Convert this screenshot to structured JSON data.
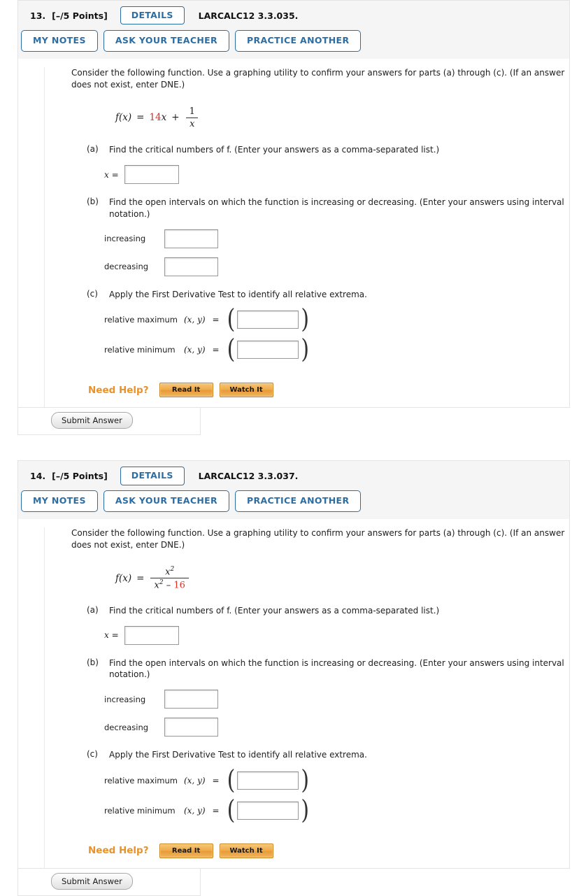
{
  "questions": [
    {
      "number": "13.",
      "points": "[–/5 Points]",
      "details_label": "DETAILS",
      "code": "LARCALC12 3.3.035.",
      "buttons": [
        "MY NOTES",
        "ASK YOUR TEACHER",
        "PRACTICE ANOTHER"
      ],
      "prompt": "Consider the following function. Use a graphing utility to confirm your answers for parts (a) through (c). (If an answer does not exist, enter DNE.)",
      "formula": {
        "lhs": "f(x)",
        "equals": "=",
        "coefficient": "14",
        "variable": "x",
        "plus": "+",
        "frac_num": "1",
        "frac_den": "x"
      },
      "parts": [
        {
          "label": "(a)",
          "text": "Find the critical numbers of f. (Enter your answers as a comma-separated list.)",
          "answers": [
            {
              "label": "x =",
              "type": "single"
            }
          ]
        },
        {
          "label": "(b)",
          "text": "Find the open intervals on which the function is increasing or decreasing. (Enter your answers using interval notation.)",
          "answers": [
            {
              "label": "increasing",
              "type": "single"
            },
            {
              "label": "decreasing",
              "type": "single"
            }
          ]
        },
        {
          "label": "(c)",
          "text": "Apply the First Derivative Test to identify all relative extrema.",
          "answers": [
            {
              "label": "relative maximum",
              "type": "pair",
              "coords": "(x, y)",
              "equals": "="
            },
            {
              "label": "relative minimum",
              "type": "pair",
              "coords": "(x, y)",
              "equals": "="
            }
          ]
        }
      ],
      "need_help_label": "Need Help?",
      "help_buttons": [
        "Read It",
        "Watch It"
      ],
      "submit_label": "Submit Answer"
    },
    {
      "number": "14.",
      "points": "[–/5 Points]",
      "details_label": "DETAILS",
      "code": "LARCALC12 3.3.037.",
      "buttons": [
        "MY NOTES",
        "ASK YOUR TEACHER",
        "PRACTICE ANOTHER"
      ],
      "prompt": "Consider the following function. Use a graphing utility to confirm your answers for parts (a) through (c). (If an answer does not exist, enter DNE.)",
      "formula": {
        "lhs": "f(x)",
        "equals": "=",
        "frac_num_base": "x",
        "frac_num_exp": "2",
        "frac_den_base": "x",
        "frac_den_exp": "2",
        "frac_den_minus": "–",
        "frac_den_const": "16"
      },
      "parts": [
        {
          "label": "(a)",
          "text": "Find the critical numbers of f. (Enter your answers as a comma-separated list.)",
          "answers": [
            {
              "label": "x =",
              "type": "single"
            }
          ]
        },
        {
          "label": "(b)",
          "text": "Find the open intervals on which the function is increasing or decreasing. (Enter your answers using interval notation.)",
          "answers": [
            {
              "label": "increasing",
              "type": "single"
            },
            {
              "label": "decreasing",
              "type": "single"
            }
          ]
        },
        {
          "label": "(c)",
          "text": "Apply the First Derivative Test to identify all relative extrema.",
          "answers": [
            {
              "label": "relative maximum",
              "type": "pair",
              "coords": "(x, y)",
              "equals": "="
            },
            {
              "label": "relative minimum",
              "type": "pair",
              "coords": "(x, y)",
              "equals": "="
            }
          ]
        }
      ],
      "need_help_label": "Need Help?",
      "help_buttons": [
        "Read It",
        "Watch It"
      ],
      "submit_label": "Submit Answer"
    }
  ],
  "colors": {
    "accent_blue": "#2c6ea4",
    "help_orange": "#e8922a",
    "formula_red": "#d93025",
    "panel_gray": "#f5f5f5"
  }
}
